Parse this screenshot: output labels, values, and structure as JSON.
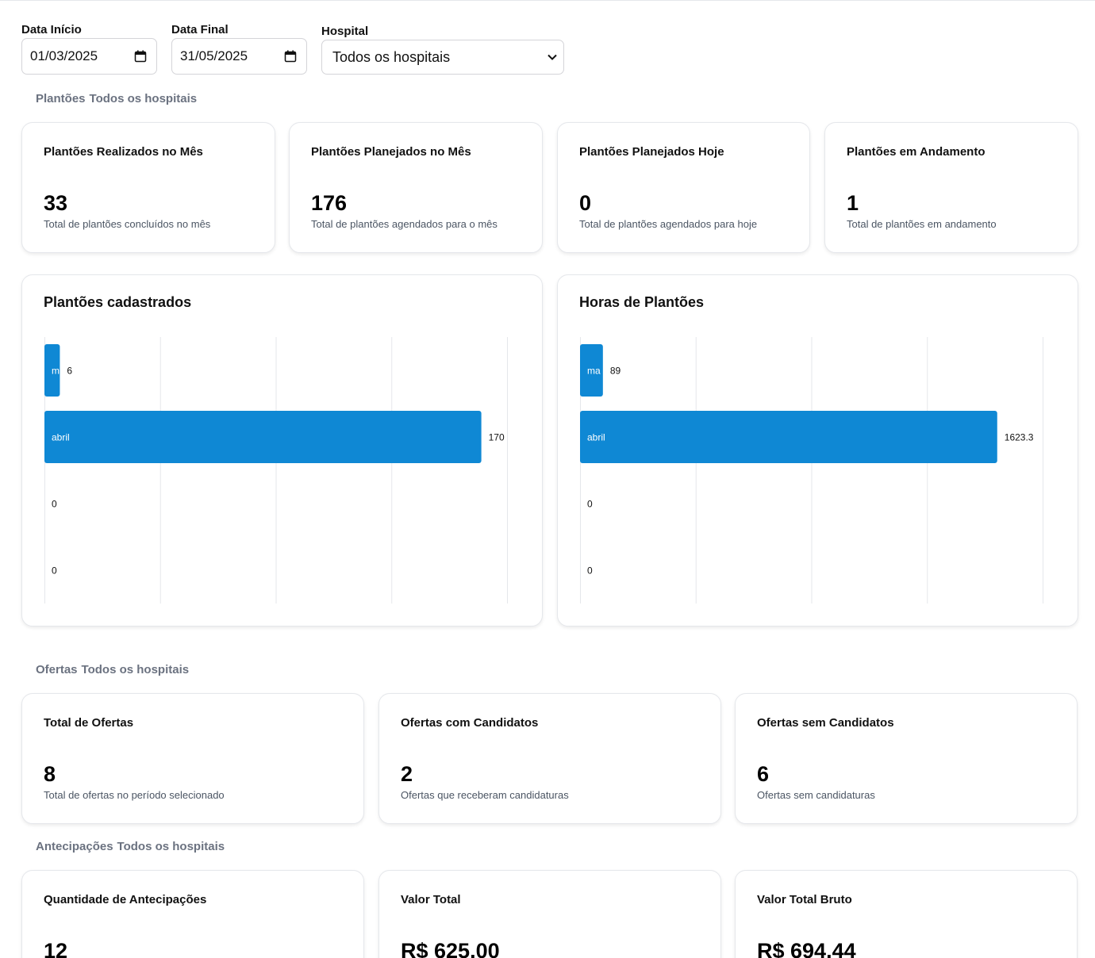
{
  "filters": {
    "start_label": "Data Início",
    "start_value": "01/03/2025",
    "end_label": "Data Final",
    "end_value": "31/05/2025",
    "hospital_label": "Hospital",
    "hospital_value": "Todos os hospitais"
  },
  "sections": {
    "plantoes": {
      "title": "Plantões",
      "hospital": "Todos os hospitais"
    },
    "ofertas": {
      "title": "Ofertas",
      "hospital": "Todos os hospitais"
    },
    "antecipacoes": {
      "title": "Antecipações",
      "hospital": "Todos os hospitais"
    }
  },
  "plantoes_stats": [
    {
      "title": "Plantões Realizados no Mês",
      "value": "33",
      "desc": "Total de plantões concluídos no mês"
    },
    {
      "title": "Plantões Planejados no Mês",
      "value": "176",
      "desc": "Total de plantões agendados para o mês"
    },
    {
      "title": "Plantões Planejados Hoje",
      "value": "0",
      "desc": "Total de plantões agendados para hoje"
    },
    {
      "title": "Plantões em Andamento",
      "value": "1",
      "desc": "Total de plantões em andamento"
    }
  ],
  "ofertas_stats": [
    {
      "title": "Total de Ofertas",
      "value": "8",
      "desc": "Total de ofertas no período selecionado"
    },
    {
      "title": "Ofertas com Candidatos",
      "value": "2",
      "desc": "Ofertas que receberam candidaturas"
    },
    {
      "title": "Ofertas sem Candidatos",
      "value": "6",
      "desc": "Ofertas sem candidaturas"
    }
  ],
  "antecipacoes_stats": [
    {
      "title": "Quantidade de Antecipações",
      "value": "12"
    },
    {
      "title": "Valor Total",
      "value": "R$ 625.00"
    },
    {
      "title": "Valor Total Bruto",
      "value": "R$ 694.44"
    }
  ],
  "colors": {
    "bar": "#0f88d4",
    "muted_text": "#6b7280",
    "border": "#e5e7eb"
  },
  "chart_data": [
    {
      "type": "bar",
      "orientation": "horizontal",
      "title": "Plantões cadastrados",
      "categories": [
        "m",
        "abril",
        "",
        ""
      ],
      "values": [
        6,
        170,
        0,
        0
      ],
      "value_labels": [
        "6",
        "170",
        "0",
        "0"
      ],
      "xlim": [
        0,
        180
      ],
      "grid": true
    },
    {
      "type": "bar",
      "orientation": "horizontal",
      "title": "Horas de Plantões",
      "categories": [
        "ma",
        "abril",
        "",
        ""
      ],
      "values": [
        89,
        1623.3,
        0,
        0
      ],
      "value_labels": [
        "89",
        "1623.3",
        "0",
        "0"
      ],
      "xlim": [
        0,
        1800
      ],
      "grid": true
    }
  ]
}
